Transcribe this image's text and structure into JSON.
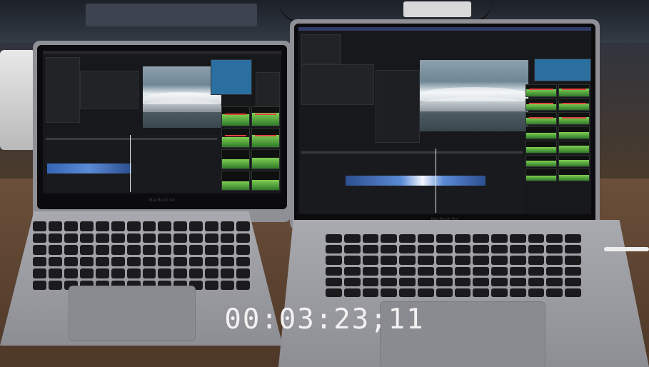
{
  "overlay": {
    "timecode": "00:03:23;11"
  },
  "left_laptop": {
    "brand": "MacBook Air"
  },
  "right_laptop": {
    "brand": "MacBook Pro"
  },
  "colors": {
    "scope_green": "#7fcf52",
    "scope_red": "#e0443d",
    "clip_blue": "#3466b5"
  }
}
